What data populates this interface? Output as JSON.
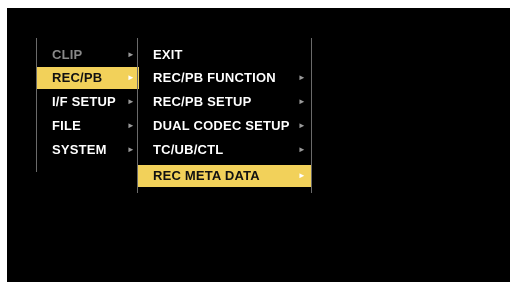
{
  "left_menu": {
    "items": [
      {
        "label": "CLIP",
        "arrow": "►"
      },
      {
        "label": "REC/PB",
        "arrow": "►"
      },
      {
        "label": "I/F SETUP",
        "arrow": "►"
      },
      {
        "label": "FILE",
        "arrow": "►"
      },
      {
        "label": "SYSTEM",
        "arrow": "►"
      }
    ]
  },
  "right_menu": {
    "items": [
      {
        "label": "EXIT"
      },
      {
        "label": "REC/PB FUNCTION",
        "arrow": "►"
      },
      {
        "label": "REC/PB SETUP",
        "arrow": "►"
      },
      {
        "label": "DUAL CODEC SETUP",
        "arrow": "►"
      },
      {
        "label": "TC/UB/CTL",
        "arrow": "►"
      },
      {
        "label": "REC META DATA",
        "arrow": "►"
      }
    ]
  },
  "colors": {
    "background": "#000000",
    "highlight": "#f2d15a",
    "text": "#ffffff",
    "disabled_text": "#8a8a8a",
    "divider": "#6a6a6a"
  }
}
